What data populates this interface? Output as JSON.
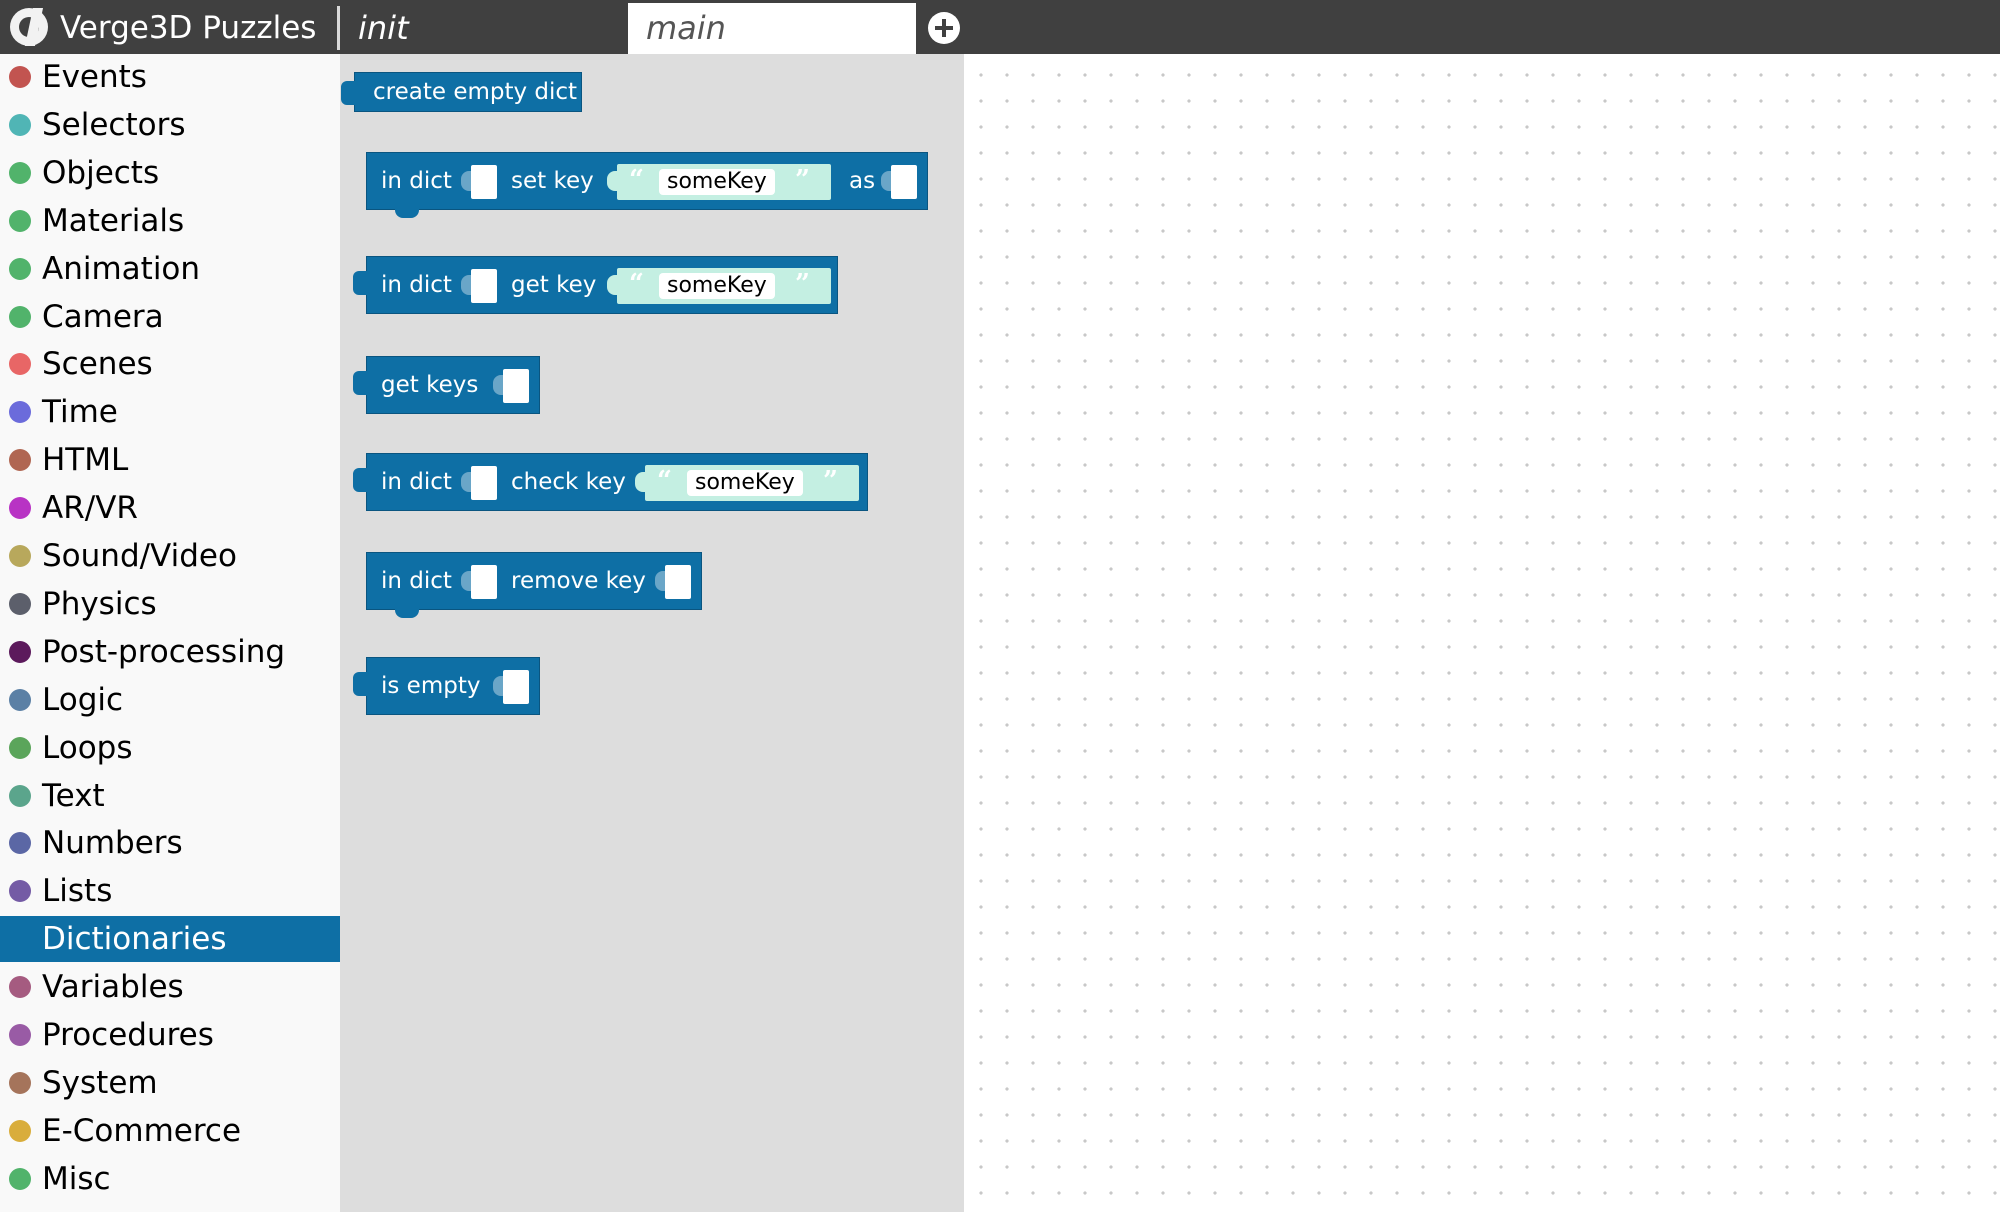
{
  "app": {
    "title": "Verge3D Puzzles",
    "tabs": [
      {
        "label": "init"
      },
      {
        "label": "main"
      }
    ],
    "add_tab_icon": "plus-circle-icon"
  },
  "sidebar": {
    "items": [
      {
        "label": "Events",
        "color": "#c25450"
      },
      {
        "label": "Selectors",
        "color": "#50b5b5"
      },
      {
        "label": "Objects",
        "color": "#51b36b"
      },
      {
        "label": "Materials",
        "color": "#51b36b"
      },
      {
        "label": "Animation",
        "color": "#51b36b"
      },
      {
        "label": "Camera",
        "color": "#51b36b"
      },
      {
        "label": "Scenes",
        "color": "#e86666"
      },
      {
        "label": "Time",
        "color": "#6b6bdb"
      },
      {
        "label": "HTML",
        "color": "#b06652"
      },
      {
        "label": "AR/VR",
        "color": "#b833c4"
      },
      {
        "label": "Sound/Video",
        "color": "#b8a85c"
      },
      {
        "label": "Physics",
        "color": "#5c5f6b"
      },
      {
        "label": "Post-processing",
        "color": "#5c1a5c"
      },
      {
        "label": "Logic",
        "color": "#5b80a5"
      },
      {
        "label": "Loops",
        "color": "#5ba55b"
      },
      {
        "label": "Text",
        "color": "#5ba58c"
      },
      {
        "label": "Numbers",
        "color": "#5b67a5"
      },
      {
        "label": "Lists",
        "color": "#745ba5"
      },
      {
        "label": "Dictionaries",
        "color": "#0e6fa5"
      },
      {
        "label": "Variables",
        "color": "#a55b80"
      },
      {
        "label": "Procedures",
        "color": "#995ba5"
      },
      {
        "label": "System",
        "color": "#a5745b"
      },
      {
        "label": "E-Commerce",
        "color": "#d9ad3b"
      },
      {
        "label": "Misc",
        "color": "#51b36b"
      }
    ],
    "selected": "Dictionaries"
  },
  "flyout": {
    "block_color": "#0e6fa5",
    "string_color": "#c4efe2",
    "blocks": {
      "create_empty_dict": {
        "label": "create empty dict"
      },
      "set_key": {
        "in_dict": "in dict",
        "label": "set key",
        "key": "someKey",
        "as": "as"
      },
      "get_key": {
        "in_dict": "in dict",
        "label": "get key",
        "key": "someKey"
      },
      "get_keys": {
        "label": "get keys"
      },
      "check_key": {
        "in_dict": "in dict",
        "label": "check key",
        "key": "someKey"
      },
      "remove_key": {
        "in_dict": "in dict",
        "label": "remove key"
      },
      "is_empty": {
        "label": "is empty"
      }
    }
  }
}
